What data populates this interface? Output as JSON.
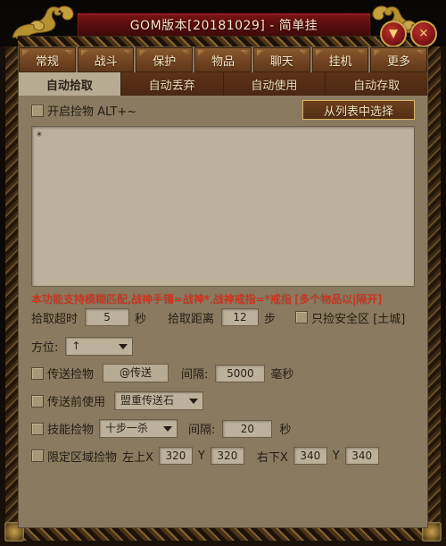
{
  "window": {
    "title": "GOM版本[20181029] - 简单挂",
    "minimize_glyph": "▼",
    "close_glyph": "✕"
  },
  "tabs": [
    {
      "label": "常规"
    },
    {
      "label": "战斗"
    },
    {
      "label": "保护"
    },
    {
      "label": "物品"
    },
    {
      "label": "聊天"
    },
    {
      "label": "挂机"
    },
    {
      "label": "更多"
    }
  ],
  "subtabs": [
    {
      "label": "自动拾取",
      "active": true
    },
    {
      "label": "自动丢弃",
      "active": false
    },
    {
      "label": "自动使用",
      "active": false
    },
    {
      "label": "自动存取",
      "active": false
    }
  ],
  "content": {
    "enable_pickup_label": "开启捡物 ALT+~",
    "select_from_list_button": "从列表中选择",
    "item_list_value": "*",
    "warning_text": "本功能支持模糊匹配,战神手镯=战神*,战神戒指=*戒指 [多个物品以|隔开]",
    "timeout_label": "拾取超时",
    "timeout_value": "5",
    "timeout_unit": "秒",
    "distance_label": "拾取距离",
    "distance_value": "12",
    "distance_unit": "步",
    "safezone_only_label": "只捡安全区 [土城]",
    "direction_label": "方位:",
    "direction_value": "↑",
    "teleport_pickup_label": "传送捡物",
    "teleport_command": "@传送",
    "teleport_interval_label": "间隔:",
    "teleport_interval_value": "5000",
    "teleport_interval_unit": "毫秒",
    "pre_teleport_use_label": "传送前使用",
    "pre_teleport_item": "盟重传送石",
    "skill_pickup_label": "技能捡物",
    "skill_name": "十步一杀",
    "skill_interval_label": "间隔:",
    "skill_interval_value": "20",
    "skill_interval_unit": "秒",
    "area_limit_label": "限定区域捡物",
    "topleft_x_label": "左上X",
    "topleft_x_value": "320",
    "topleft_y_label": "Y",
    "topleft_y_value": "320",
    "bottomright_x_label": "右下X",
    "bottomright_x_value": "340",
    "bottomright_y_label": "Y",
    "bottomright_y_value": "340"
  },
  "colors": {
    "title_bar_red": "#5c0d0d",
    "panel_bg": "#8a7a60",
    "tab_brown": "#7a4b25",
    "active_subtab": "#b8ab93",
    "warning_red": "#e02a15",
    "gold": "#c9a64e"
  }
}
